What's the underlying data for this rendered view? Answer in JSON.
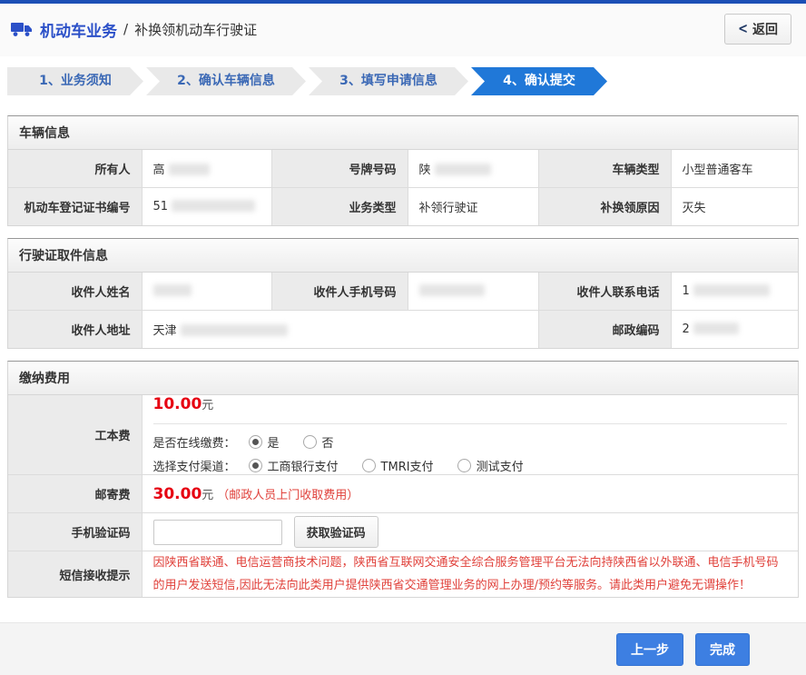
{
  "header": {
    "title": "机动车业务",
    "separator": "/",
    "subtitle": "补换领机动车行驶证",
    "back_label": "返回"
  },
  "icons": {
    "back_chevron": "<",
    "truck": "truck-icon"
  },
  "steps": [
    {
      "label": "1、业务须知",
      "active": false
    },
    {
      "label": "2、确认车辆信息",
      "active": false
    },
    {
      "label": "3、填写申请信息",
      "active": false
    },
    {
      "label": "4、确认提交",
      "active": true
    }
  ],
  "vehicle_info": {
    "title": "车辆信息",
    "fields": {
      "owner": {
        "label": "所有人",
        "value": "高"
      },
      "plate": {
        "label": "号牌号码",
        "value": "陕"
      },
      "vehicle_type": {
        "label": "车辆类型",
        "value": "小型普通客车"
      },
      "reg_cert_no": {
        "label": "机动车登记证书编号",
        "value": "51"
      },
      "business_type": {
        "label": "业务类型",
        "value": "补领行驶证"
      },
      "reason": {
        "label": "补换领原因",
        "value": "灭失"
      }
    }
  },
  "pickup_info": {
    "title": "行驶证取件信息",
    "fields": {
      "recipient_name": {
        "label": "收件人姓名",
        "value": ""
      },
      "recipient_mobile": {
        "label": "收件人手机号码",
        "value": ""
      },
      "recipient_phone": {
        "label": "收件人联系电话",
        "value": "1"
      },
      "recipient_address": {
        "label": "收件人地址",
        "value": "天津"
      },
      "postal_code": {
        "label": "邮政编码",
        "value": "2"
      }
    }
  },
  "fees": {
    "title": "缴纳费用",
    "production_fee": {
      "label": "工本费",
      "amount": "10.00",
      "unit": "元",
      "online_question": "是否在线缴费：",
      "online_options": [
        {
          "label": "是",
          "checked": true
        },
        {
          "label": "否",
          "checked": false
        }
      ],
      "channel_question": "选择支付渠道：",
      "channel_options": [
        {
          "label": "工商银行支付",
          "checked": true
        },
        {
          "label": "TMRI支付",
          "checked": false
        },
        {
          "label": "测试支付",
          "checked": false
        }
      ]
    },
    "mail_fee": {
      "label": "邮寄费",
      "amount": "30.00",
      "unit": "元",
      "note": "（邮政人员上门收取费用）"
    },
    "sms_code": {
      "label": "手机验证码",
      "input_value": "",
      "button": "获取验证码"
    },
    "sms_notice": {
      "label": "短信接收提示",
      "text": "因陕西省联通、电信运营商技术问题，陕西省互联网交通安全综合服务管理平台无法向持陕西省以外联通、电信手机号码的用户发送短信,因此无法向此类用户提供陕西省交通管理业务的网上办理/预约等服务。请此类用户避免无谓操作！"
    }
  },
  "footer": {
    "prev_button": "上一步",
    "finish_button": "完成"
  },
  "colors": {
    "top_bar": "#1c4fb6",
    "title_blue": "#2b50c8",
    "step_active_blue": "#2078d8",
    "step_text_blue": "#3a68b5",
    "button_blue": "#3d7fe2",
    "price_red": "#e60012",
    "notice_red": "#e0403a",
    "label_cell_bg": "#ebebeb"
  }
}
